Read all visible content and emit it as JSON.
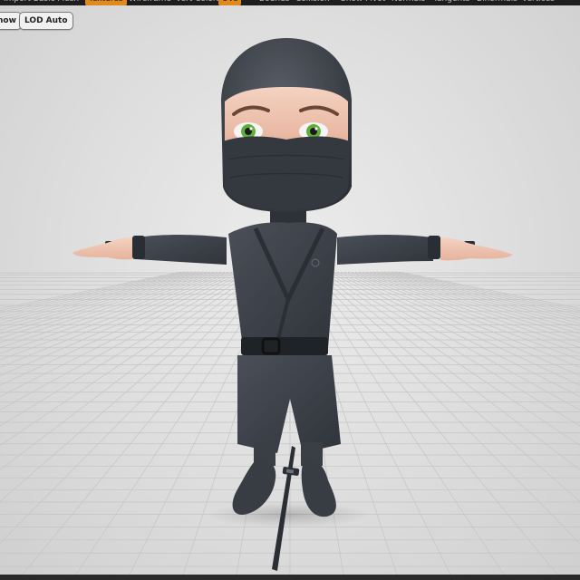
{
  "toolbar": {
    "items": [
      {
        "label": "Import Basic Mesh",
        "active": false
      },
      {
        "label": "Textures",
        "active": true
      },
      {
        "label": "Wireframe",
        "active": false
      },
      {
        "label": "Vert Colors",
        "active": false
      },
      {
        "label": "UVs",
        "active": true
      },
      {
        "label": "Bounds",
        "active": false
      },
      {
        "label": "Collision",
        "active": false
      },
      {
        "label": "Show Pivot",
        "active": false
      },
      {
        "label": "Normals",
        "active": false
      },
      {
        "label": "Tangents",
        "active": false
      },
      {
        "label": "Binormals",
        "active": false
      },
      {
        "label": "Vertices",
        "active": false
      }
    ],
    "accent_color": "#e08a1e"
  },
  "viewport": {
    "show_button_label": "how",
    "lod_button_label": "LOD Auto",
    "background_color": "#e4e4e4"
  },
  "model": {
    "subject": "chibi ninja character in T-pose",
    "outfit_color": "#3b3f47",
    "skin_color": "#efc4b0",
    "eye_color": "#5fae3a"
  }
}
